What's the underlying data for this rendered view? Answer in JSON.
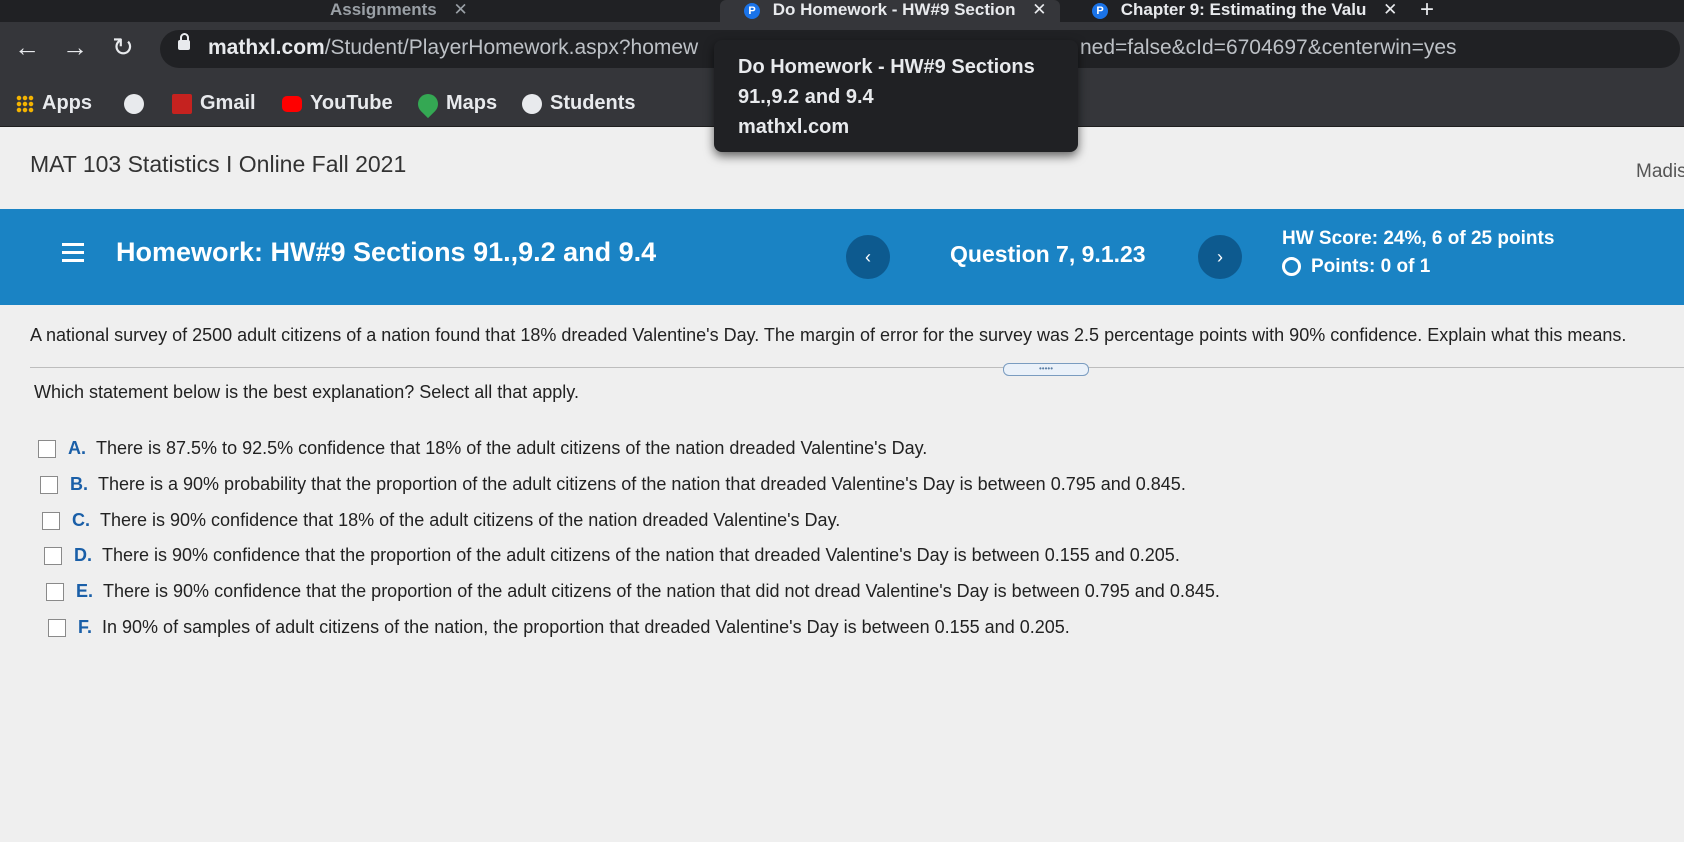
{
  "browser": {
    "tabs": [
      {
        "label": "Assignments"
      },
      {
        "label": "Do Homework - HW#9 Section"
      },
      {
        "label": "Chapter 9: Estimating the Valu"
      }
    ],
    "new_tab": "+",
    "url_host": "mathxl.com",
    "url_path": "/Student/PlayerHomework.aspx?homew",
    "url_tail": "ned=false&cId=6704697&centerwin=yes",
    "bookmarks": [
      {
        "label": "Apps",
        "color": "#f4b400"
      },
      {
        "label": "",
        "color": "#ffffff"
      },
      {
        "label": "Gmail",
        "color": "#c5221f"
      },
      {
        "label": "YouTube",
        "color": "#ff0000"
      },
      {
        "label": "Maps",
        "color": "#34a853"
      },
      {
        "label": "Students",
        "color": "#ffffff"
      }
    ],
    "tooltip": {
      "line1": "Do Homework - HW#9 Sections",
      "line2": "91.,9.2 and 9.4",
      "host": "mathxl.com"
    }
  },
  "page": {
    "course_title": "MAT 103 Statistics I Online Fall 2021",
    "user_name": "Madis",
    "homework_title": "Homework: HW#9 Sections 91.,9.2 and 9.4",
    "prev": "‹",
    "next": "›",
    "question_label": "Question 7, 9.1.23",
    "hw_score": "HW Score: 24%, 6 of 25 points",
    "points": "Points: 0 of 1",
    "problem_text": "A national survey of 2500 adult citizens of a nation found that 18% dreaded Valentine's Day. The margin of error for the survey was 2.5 percentage points with 90% confidence. Explain what this means.",
    "handle_text": "•••••",
    "prompt": "Which statement below is the best explanation? Select all that apply.",
    "options": [
      {
        "letter": "A.",
        "text": "There is 87.5% to 92.5% confidence that 18% of the adult citizens of the nation dreaded Valentine's Day."
      },
      {
        "letter": "B.",
        "text": "There is a 90% probability that the proportion of the adult citizens of the nation that dreaded Valentine's Day is between 0.795 and 0.845."
      },
      {
        "letter": "C.",
        "text": "There is 90% confidence that 18% of the adult citizens of the nation dreaded Valentine's Day."
      },
      {
        "letter": "D.",
        "text": "There is 90% confidence that the proportion of the adult citizens of the nation that dreaded Valentine's Day is between 0.155 and 0.205."
      },
      {
        "letter": "E.",
        "text": "There is 90% confidence that the proportion of the adult citizens of the nation that did not dread Valentine's Day is between 0.795 and 0.845."
      },
      {
        "letter": "F.",
        "text": "In 90% of samples of adult citizens of the nation, the proportion that dreaded Valentine's Day is between 0.155 and 0.205."
      }
    ]
  },
  "colors": {
    "banner": "#1a83c4",
    "option_letter": "#1a5fa8",
    "chrome": "#35363a"
  }
}
